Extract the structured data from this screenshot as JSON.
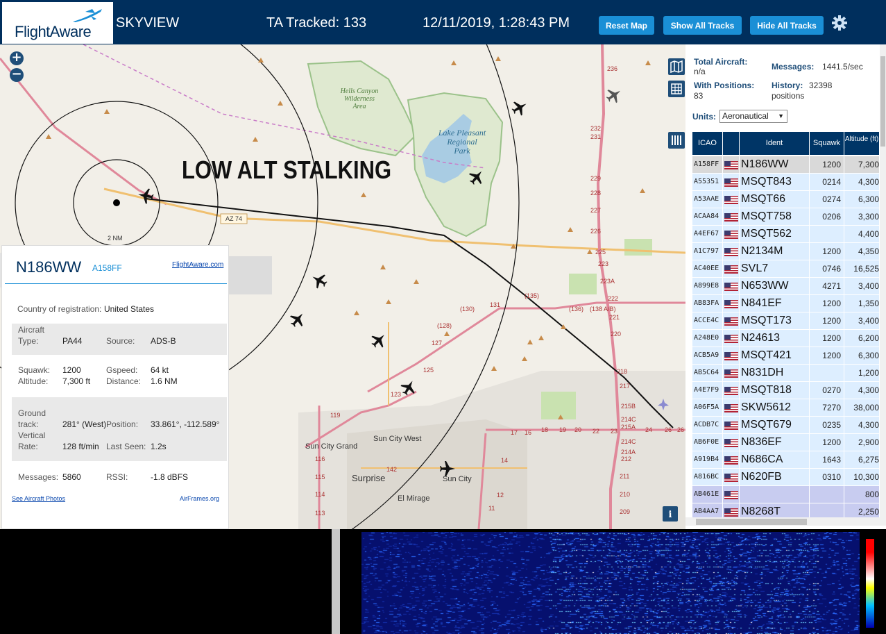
{
  "header": {
    "logo_text": "FlightAware",
    "app_name": "SKYVIEW",
    "ta_tracked": "TA Tracked: 133",
    "datetime": "12/11/2019, 1:28:43 PM",
    "btn_reset": "Reset Map",
    "btn_show": "Show All Tracks",
    "btn_hide": "Hide All Tracks",
    "settings_icon": "gear-icon"
  },
  "map": {
    "overlay_text": "LOW ALT STALKING",
    "range_label": "2 NM",
    "places": {
      "hells_canyon": [
        "Hells Canyon",
        "Wilderness",
        "Area"
      ],
      "lake_pleasant": [
        "Lake Pleasant",
        "Regional",
        "Park"
      ],
      "sun_city_grand": "Sun City Grand",
      "sun_city_west": "Sun City West",
      "surprise": "Surprise",
      "sun_city": "Sun City",
      "el_mirage": "El Mirage"
    },
    "roads": {
      "az74": "AZ 74",
      "r130": "(130)",
      "r135": "(135)",
      "r136": "(136)",
      "r138": "(138 A/B)",
      "r128": "(128)",
      "n131": "131",
      "n127": "127",
      "n125": "125",
      "n123": "123",
      "n119": "119",
      "n116": "116",
      "n115": "115",
      "n114": "114",
      "n113": "113",
      "n142": "142",
      "n14": "14",
      "n12": "12",
      "n11": "11",
      "i17_numbers": [
        "236",
        "232",
        "231",
        "229",
        "228",
        "227",
        "226",
        "225",
        "223",
        "223A",
        "222",
        "221",
        "220",
        "218",
        "217",
        "215B",
        "214C",
        "215A",
        "214C",
        "214A",
        "212",
        "211",
        "210",
        "209"
      ],
      "exit_row": [
        "17",
        "16",
        "18",
        "19",
        "20",
        "22",
        "23",
        "24",
        "26",
        "26"
      ]
    },
    "ctrl_icons": [
      "map-layers-icon",
      "grid-icon",
      "columns-icon"
    ],
    "info_icon": "info-icon"
  },
  "selected": {
    "ident": "N186WW",
    "icao": "A158FF",
    "fa_link": "FlightAware.com",
    "country_label": "Country of registration:",
    "country": "United States",
    "aircraft_label": "Aircraft",
    "type_label": "Type:",
    "type": "PA44",
    "source_label": "Source:",
    "source": "ADS-B",
    "squawk_label": "Squawk:",
    "squawk": "1200",
    "gspeed_label": "Gspeed:",
    "gspeed": "64 kt",
    "altitude_label": "Altitude:",
    "altitude": "7,300 ft",
    "distance_label": "Distance:",
    "distance": "1.6 NM",
    "ground_label": "Ground",
    "track_label": "track:",
    "track": "281° (West)",
    "position_label": "Position:",
    "position": "33.861°, -112.589°",
    "vertical_label": "Vertical",
    "rate_label": "Rate:",
    "rate": "128 ft/min",
    "lastseen_label": "Last Seen:",
    "lastseen": "1.2s",
    "messages_label": "Messages:",
    "messages": "5860",
    "rssi_label": "RSSI:",
    "rssi": "-1.8 dBFS",
    "photos_link": "See Aircraft Photos",
    "airframes_link": "AirFrames.org"
  },
  "stats": {
    "total_label": "Total Aircraft:",
    "total": "n/a",
    "messages_label": "Messages:",
    "messages": "1441.5/sec",
    "with_pos_label": "With Positions:",
    "with_pos": "83",
    "history_label": "History:",
    "history": "32398",
    "history_unit": "positions",
    "units_label": "Units:",
    "units_value": "Aeronautical"
  },
  "table": {
    "headers": [
      "ICAO",
      "",
      "Ident",
      "Squawk",
      "Altitude (ft)"
    ],
    "rows": [
      {
        "icao": "A158FF",
        "ident": "N186WW",
        "squawk": "1200",
        "alt": "7,300",
        "style": "selected"
      },
      {
        "icao": "A55351",
        "ident": "MSQT843",
        "squawk": "0214",
        "alt": "4,300",
        "style": "normal"
      },
      {
        "icao": "A53AAE",
        "ident": "MSQT66",
        "squawk": "0274",
        "alt": "6,300",
        "style": "normal"
      },
      {
        "icao": "ACAA84",
        "ident": "MSQT758",
        "squawk": "0206",
        "alt": "3,300",
        "style": "normal"
      },
      {
        "icao": "A4EF67",
        "ident": "MSQT562",
        "squawk": "",
        "alt": "4,400",
        "style": "normal"
      },
      {
        "icao": "A1C797",
        "ident": "N2134M",
        "squawk": "1200",
        "alt": "4,350",
        "style": "normal"
      },
      {
        "icao": "AC40EE",
        "ident": "SVL7",
        "squawk": "0746",
        "alt": "16,525",
        "style": "normal"
      },
      {
        "icao": "A899E8",
        "ident": "N653WW",
        "squawk": "4271",
        "alt": "3,400",
        "style": "normal"
      },
      {
        "icao": "AB83FA",
        "ident": "N841EF",
        "squawk": "1200",
        "alt": "1,350",
        "style": "normal"
      },
      {
        "icao": "ACCE4C",
        "ident": "MSQT173",
        "squawk": "1200",
        "alt": "3,400",
        "style": "normal"
      },
      {
        "icao": "A248E0",
        "ident": "N24613",
        "squawk": "1200",
        "alt": "6,200",
        "style": "normal"
      },
      {
        "icao": "ACB5A9",
        "ident": "MSQT421",
        "squawk": "1200",
        "alt": "6,300",
        "style": "normal"
      },
      {
        "icao": "AB5C64",
        "ident": "N831DH",
        "squawk": "",
        "alt": "1,200",
        "style": "normal"
      },
      {
        "icao": "A4E7F9",
        "ident": "MSQT818",
        "squawk": "0270",
        "alt": "4,300",
        "style": "normal"
      },
      {
        "icao": "A06F5A",
        "ident": "SKW5612",
        "squawk": "7270",
        "alt": "38,000",
        "style": "normal"
      },
      {
        "icao": "ACDB7C",
        "ident": "MSQT679",
        "squawk": "0235",
        "alt": "4,300",
        "style": "normal"
      },
      {
        "icao": "AB6F0E",
        "ident": "N836EF",
        "squawk": "1200",
        "alt": "2,900",
        "style": "normal"
      },
      {
        "icao": "A919B4",
        "ident": "N686CA",
        "squawk": "1643",
        "alt": "6,275",
        "style": "normal"
      },
      {
        "icao": "A816BC",
        "ident": "N620FB",
        "squawk": "0310",
        "alt": "10,300",
        "style": "normal"
      },
      {
        "icao": "AB461E",
        "ident": "",
        "squawk": "",
        "alt": "800",
        "style": "mlat"
      },
      {
        "icao": "AB4AA7",
        "ident": "N8268T",
        "squawk": "",
        "alt": "2,250",
        "style": "mlat"
      }
    ]
  },
  "colors": {
    "header_bg": "#002f5d",
    "button": "#1a8fd6",
    "table_head": "#003566",
    "row_normal": "#ddeeff",
    "row_selected": "#d9d9d9",
    "row_mlat": "#c8ccf0"
  }
}
